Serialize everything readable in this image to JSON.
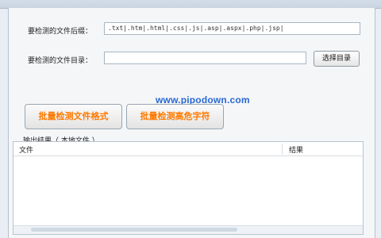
{
  "form": {
    "extensions_label": "要检测的文件后缀：",
    "extensions_value": ".txt|.htm|.html|.css|.js|.asp|.aspx|.php|.jsp|",
    "directory_label": "要检测的文件目录：",
    "directory_value": "",
    "select_dir_button": "选择目录"
  },
  "actions": {
    "batch_check_format": "批量检测文件格式",
    "batch_check_highlight": "批量检测高危字符"
  },
  "watermark": "www.pipodown.com",
  "results": {
    "label": "输出结果（ 本地文件 ）",
    "columns": [
      "文件",
      "结果"
    ]
  },
  "colors": {
    "action_text": "#ff7a00",
    "watermark": "#2a68d1"
  }
}
